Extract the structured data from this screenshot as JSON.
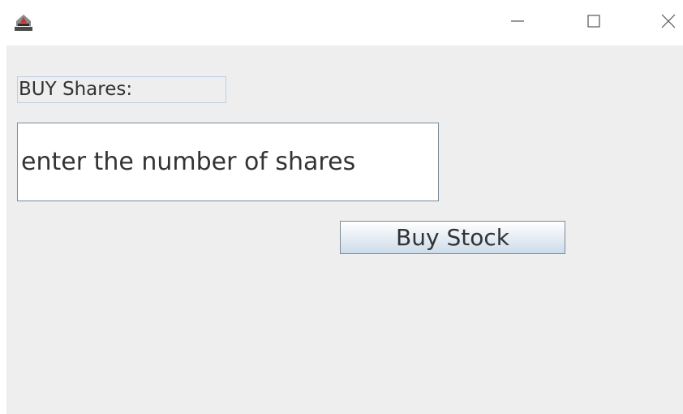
{
  "window": {
    "icon": "java-cup-icon",
    "controls": [
      "minimize-icon",
      "maximize-icon",
      "close-icon"
    ]
  },
  "form": {
    "label": "BUY Shares:",
    "shares_input_value": "enter the number of shares",
    "buy_button_label": "Buy Stock"
  },
  "colors": {
    "panel_bg": "#eeeeee",
    "label_border": "#b8cfe5",
    "control_border": "#7a8a99",
    "text": "#333333"
  }
}
